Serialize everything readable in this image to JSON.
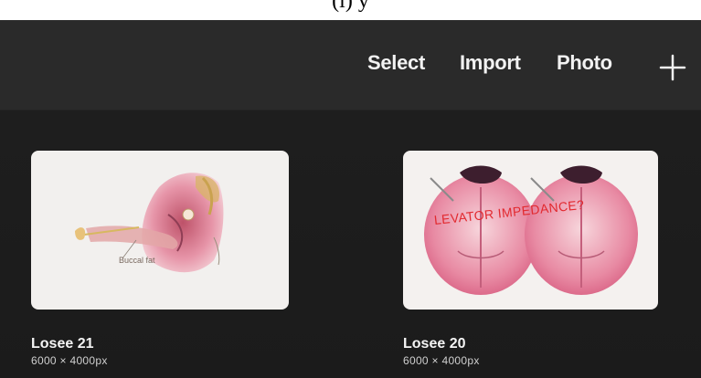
{
  "caption": "(i) y",
  "toolbar": {
    "select_label": "Select",
    "import_label": "Import",
    "photo_label": "Photo",
    "add_icon": "plus-icon"
  },
  "gallery": {
    "items": [
      {
        "title": "Losee 21",
        "dimensions": "6000 × 4000px",
        "illustration_label": "Buccal fat"
      },
      {
        "title": "Losee 20",
        "dimensions": "6000 × 4000px",
        "illustration_label": "LEVATOR IMPEDANCE?"
      }
    ]
  },
  "colors": {
    "background": "#1b1b1b",
    "topbar": "#2a2a2a",
    "text": "#f2f2f2",
    "annotation": "#e22a30"
  }
}
